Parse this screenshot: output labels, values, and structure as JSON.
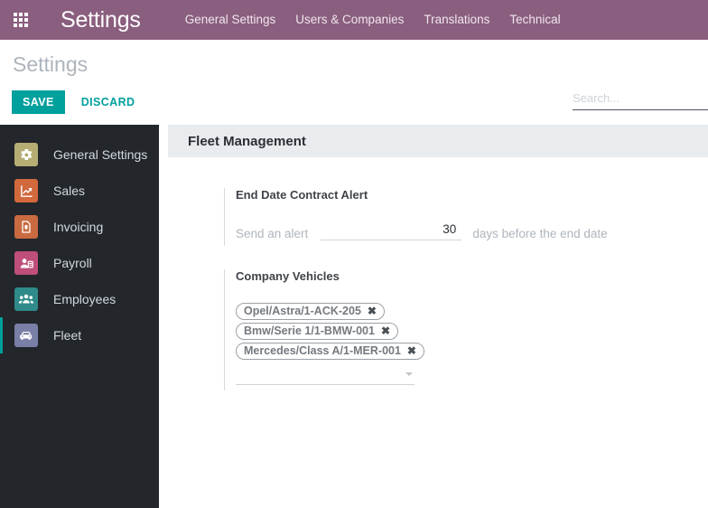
{
  "topbar": {
    "apps_icon": "apps-grid-icon",
    "brand": "Settings",
    "menu": [
      {
        "label": "General Settings"
      },
      {
        "label": "Users & Companies"
      },
      {
        "label": "Translations"
      },
      {
        "label": "Technical"
      }
    ],
    "bg_color": "#8a5e7e"
  },
  "control_panel": {
    "title": "Settings",
    "save_label": "SAVE",
    "discard_label": "DISCARD",
    "accent_color": "#00a09d",
    "search": {
      "value": "",
      "placeholder": "Search..."
    }
  },
  "sidebar": {
    "items": [
      {
        "label": "General Settings",
        "icon": "gear-icon",
        "tile_color": "#b6ad74",
        "active": false
      },
      {
        "label": "Sales",
        "icon": "chart-line-up-icon",
        "tile_color": "#d2693c",
        "active": false
      },
      {
        "label": "Invoicing",
        "icon": "invoice-dollar-icon",
        "tile_color": "#c96a40",
        "active": false
      },
      {
        "label": "Payroll",
        "icon": "person-badge-icon",
        "tile_color": "#bf4f7a",
        "active": false
      },
      {
        "label": "Employees",
        "icon": "people-group-icon",
        "tile_color": "#2e8b8a",
        "active": false
      },
      {
        "label": "Fleet",
        "icon": "car-icon",
        "tile_color": "#7a7fa8",
        "active": true
      }
    ],
    "active_indicator_color": "#00a09d"
  },
  "content": {
    "panel_title": "Fleet Management",
    "blocks": [
      {
        "title": "End Date Contract Alert",
        "alert_label": "Send an alert",
        "alert_value": "30",
        "alert_suffix": "days before the end date"
      },
      {
        "title": "Company Vehicles",
        "tags": [
          {
            "label": "Opel/Astra/1-ACK-205",
            "remove": "✖"
          },
          {
            "label": "Bmw/Serie 1/1-BMW-001",
            "remove": "✖"
          },
          {
            "label": "Mercedes/Class A/1-MER-001",
            "remove": "✖"
          }
        ],
        "dropdown_icon": "chevron-down-icon"
      }
    ]
  }
}
